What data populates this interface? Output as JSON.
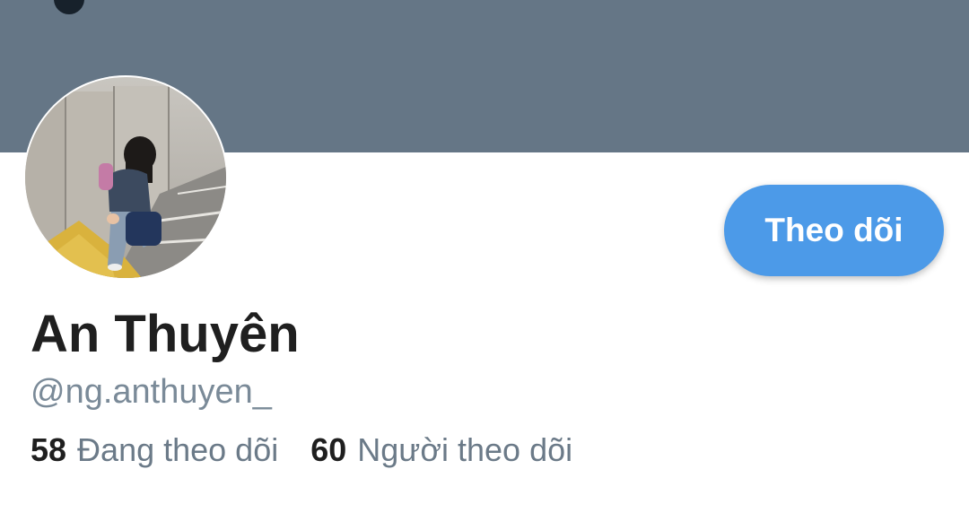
{
  "profile": {
    "display_name": "An Thuyên",
    "handle": "@ng.anthuyen_",
    "follow_button_label": "Theo dõi"
  },
  "stats": {
    "following_count": "58",
    "following_label": "Đang theo dõi",
    "followers_count": "60",
    "followers_label": "Người theo dõi"
  },
  "colors": {
    "banner": "#657686",
    "accent": "#4c9ae8"
  }
}
